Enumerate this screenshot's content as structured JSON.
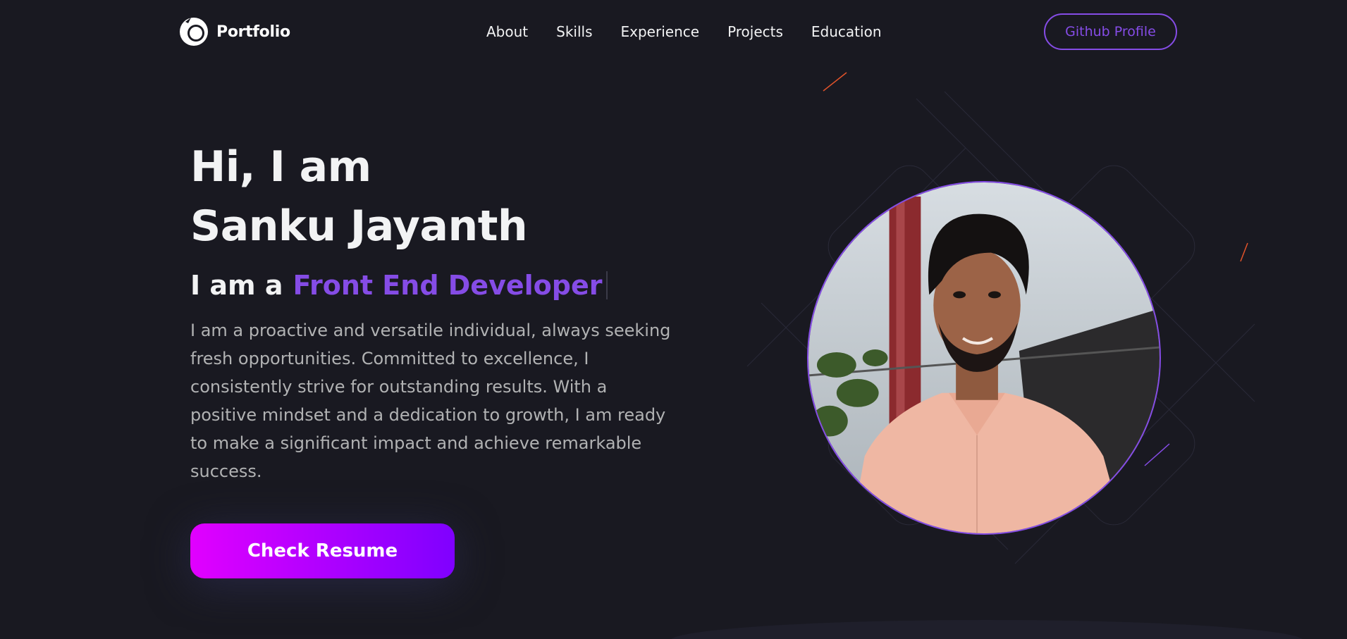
{
  "nav": {
    "logo_text": "Portfolio",
    "logo_icon": "portfolio-logo-icon",
    "links": [
      "About",
      "Skills",
      "Experience",
      "Projects",
      "Education"
    ],
    "github_label": "Github Profile"
  },
  "hero": {
    "title_line1": "Hi, I am",
    "title_line2": "Sanku Jayanth",
    "role_prefix": "I am a",
    "role_typed": "Front End Developer",
    "bio": "I am a proactive and versatile individual, always seeking fresh opportunities. Committed to excellence, I consistently strive for outstanding results. With a positive mindset and a dedication to growth, I am ready to make a significant impact and achieve remarkable success.",
    "resume_label": "Check Resume",
    "profile_image": "profile-photo"
  },
  "colors": {
    "background": "#191921",
    "primary": "#854ce6",
    "text": "#f2f3f4",
    "text_secondary": "#b1b2b3",
    "button_gradient_start": "#e100ff",
    "button_gradient_end": "#7f00ff"
  }
}
